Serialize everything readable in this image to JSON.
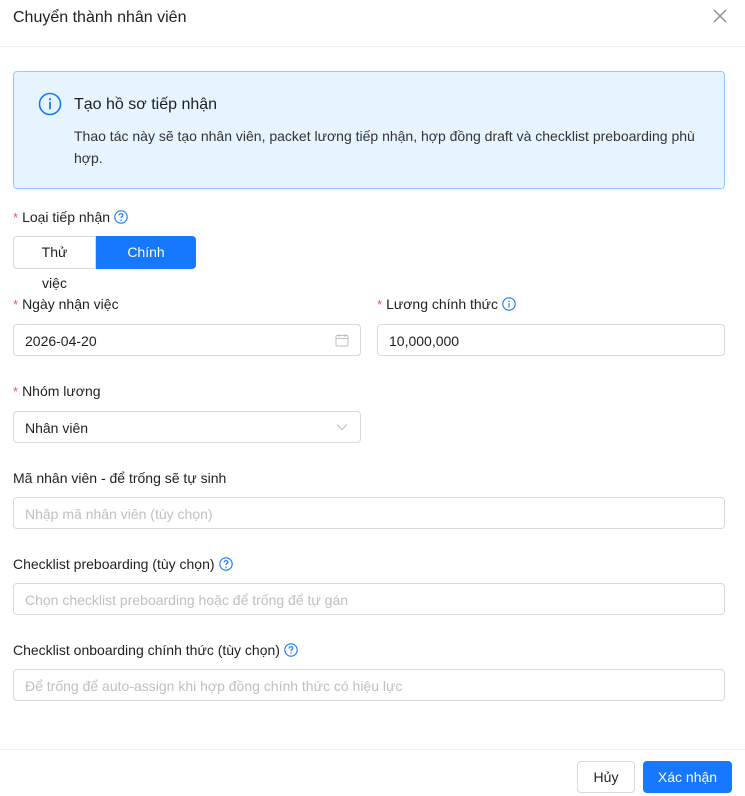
{
  "dialog": {
    "title": "Chuyển thành nhân viên",
    "close_icon": "close-icon"
  },
  "alert": {
    "icon": "info-circle-icon",
    "title": "Tạo hồ sơ tiếp nhận",
    "description": "Thao tác này sẽ tạo nhân viên, packet lương tiếp nhận, hợp đồng draft và checklist preboarding phù hợp."
  },
  "form": {
    "intake_type": {
      "label": "Loại tiếp nhận",
      "required": true,
      "help_icon": "question-circle-icon",
      "options": [
        "Thử việc",
        "Chính thức"
      ],
      "selected": "Chính thức"
    },
    "start_date": {
      "label": "Ngày nhận việc",
      "required": true,
      "value": "2026-04-20",
      "icon": "calendar-icon"
    },
    "official_salary": {
      "label": "Lương chính thức",
      "required": true,
      "info_icon": "info-circle-icon",
      "value": "10,000,000"
    },
    "salary_group": {
      "label": "Nhóm lương",
      "required": true,
      "value": "Nhân viên",
      "icon": "chevron-down-icon"
    },
    "employee_code": {
      "label": "Mã nhân viên - để trống sẽ tự sinh",
      "placeholder": "Nhập mã nhân viên (tùy chọn)"
    },
    "preboarding_checklist": {
      "label": "Checklist preboarding (tùy chọn)",
      "help_icon": "question-circle-icon",
      "placeholder": "Chọn checklist preboarding hoặc để trống để tự gán"
    },
    "onboarding_checklist": {
      "label": "Checklist onboarding chính thức (tùy chọn)",
      "help_icon": "question-circle-icon",
      "placeholder": "Để trống để auto-assign khi hợp đồng chính thức có hiệu lực"
    }
  },
  "footer": {
    "cancel_label": "Hủy",
    "confirm_label": "Xác nhận"
  },
  "colors": {
    "primary": "#1677ff",
    "alert_bg": "#e6f4ff",
    "alert_border": "#91caff",
    "required": "#ff4d4f"
  }
}
